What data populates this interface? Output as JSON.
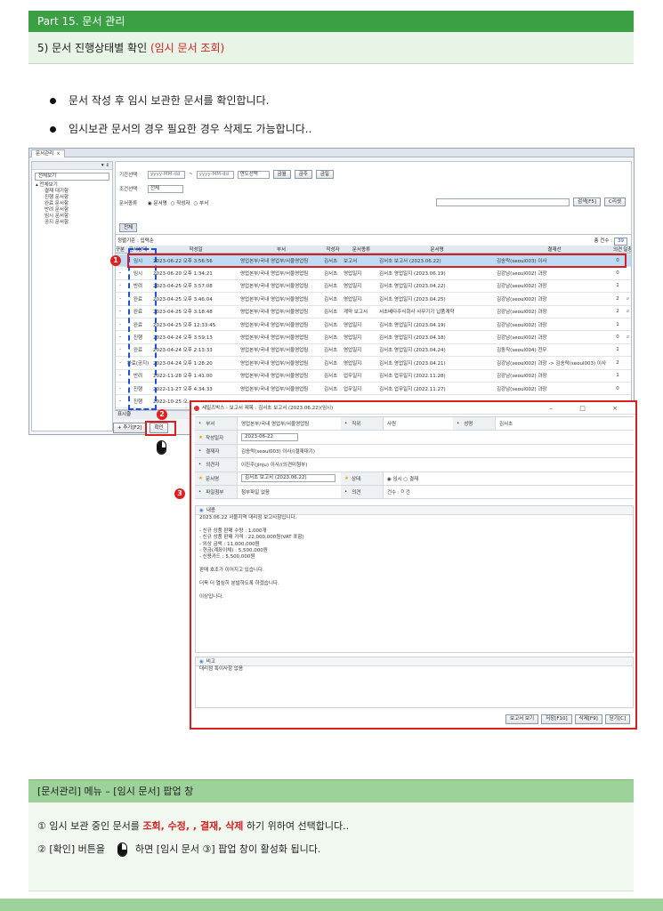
{
  "header": {
    "part": "Part 15. 문서 관리",
    "section_prefix": "5) 문서 진행상태별 확인",
    "section_highlight": "(임시 문서 조회)"
  },
  "bullets": [
    "문서 작성 후 임시 보관한 문서를 확인합니다.",
    "임시보관 문서의 경우 필요한 경우 삭제도 가능합니다.."
  ],
  "app": {
    "tab_label": "문서관리",
    "tab_close": "×",
    "tree_top": "▾ ⇓",
    "tree_search": "전체보기",
    "tree_root": "▴ 전체보기",
    "tree_items": [
      "결재 대기함",
      "진행 문서함",
      "완료 문서함",
      "반려 문서함",
      "임시 문서함",
      "공지 문서함"
    ],
    "filter": {
      "period_label": "기간선택",
      "date_from": "yyyy-MM-dd",
      "date_to": "yyyy-MM-dd",
      "year_select": "연도선택",
      "btn_week": "금월",
      "btn_month": "금주",
      "btn_today": "금일",
      "cond_label": "조건선택",
      "cond_value": "전체",
      "kind_label": "문서종류",
      "radio1": "◉ 문서명",
      "radio2": "○ 작성자",
      "radio3": "○ 부서",
      "search_btn": "검색[F5]",
      "reset_btn": "C리셋",
      "all_tab": "전체"
    },
    "grid": {
      "info_left": "정렬기준 : 입력순",
      "info_right": "총 건수 :",
      "total": "39",
      "headers": {
        "gubun": "구분",
        "status": "문서상태",
        "date": "작성일",
        "dept": "부서",
        "writer": "작성자",
        "kind": "문서종류",
        "name": "문서명",
        "approver": "결재선",
        "opinion": "의견",
        "file": "파일첨부"
      },
      "rows": [
        {
          "gubun": "-",
          "status": "임시",
          "date": "2023-06-22 오후 3:56:56",
          "dept": "영업본부/국내 영업부/서울영업팀",
          "writer": "김서초",
          "kind": "보고서",
          "name": "김서초 보고서 (2023.06.22)",
          "approver": "김송락(seoul003) 이사",
          "opinion": "0",
          "file": ""
        },
        {
          "gubun": "-",
          "status": "임시",
          "date": "2023-06-20 오후 1:34:21",
          "dept": "영업본부/국내 영업부/서울영업팀",
          "writer": "김서초",
          "kind": "영업일지",
          "name": "김서초 영업일지 (2023.06.19)",
          "approver": "김강남(seoul002) 과장",
          "opinion": "0",
          "file": ""
        },
        {
          "gubun": "-",
          "status": "반려",
          "date": "2023-04-25 오후 3:57:08",
          "dept": "영업본부/국내 영업부/서울영업팀",
          "writer": "김서초",
          "kind": "영업일지",
          "name": "김서초 영업일지 (2023.04.22)",
          "approver": "김강남(seoul002) 과장",
          "opinion": "1",
          "file": ""
        },
        {
          "gubun": "-",
          "status": "완료",
          "date": "2023-04-25 오후 3:46:04",
          "dept": "영업본부/국내 영업부/서울영업팀",
          "writer": "김서초",
          "kind": "영업일지",
          "name": "김서초 영업일지 (2023.04.25)",
          "approver": "김강남(seoul002) 과장",
          "opinion": "2",
          "file": "clip"
        },
        {
          "gubun": "-",
          "status": "완료",
          "date": "2023-04-25 오후 3:18:48",
          "dept": "영업본부/국내 영업부/서울영업팀",
          "writer": "김서초",
          "kind": "계약 보고서",
          "name": "서초베타주식회사 사무기기 납품계약",
          "approver": "김강남(seoul002) 과장",
          "opinion": "2",
          "file": "clip"
        },
        {
          "gubun": "-",
          "status": "완료",
          "date": "2023-04-25 오후 12:33:45",
          "dept": "영업본부/국내 영업부/서울영업팀",
          "writer": "김서초",
          "kind": "영업일지",
          "name": "김서초 영업일지 (2023.04.19)",
          "approver": "김강남(seoul002) 과장",
          "opinion": "1",
          "file": ""
        },
        {
          "gubun": "-",
          "status": "진행",
          "date": "2023-04-24 오후 3:59:13",
          "dept": "영업본부/국내 영업부/서울영업팀",
          "writer": "김서초",
          "kind": "영업일지",
          "name": "김서초 영업일지 (2023.04.18)",
          "approver": "김강남(seoul002) 과장",
          "opinion": "0",
          "file": "clip"
        },
        {
          "gubun": "-",
          "status": "완료",
          "date": "2023-04-24 오후 2:13:33",
          "dept": "영업본부/국내 영업부/서울영업팀",
          "writer": "김서초",
          "kind": "영업일지",
          "name": "김서초 영업일지 (2023.04.24)",
          "approver": "김동작(seoul004) 전무",
          "opinion": "1",
          "file": ""
        },
        {
          "gubun": "-",
          "status": "완료(공지)",
          "date": "2023-04-24 오후 1:28:20",
          "dept": "영업본부/국내 영업부/서울영업팀",
          "writer": "김서초",
          "kind": "영업일지",
          "name": "김서초 영업일지 (2023.04.21)",
          "approver": "김강남(seoul002) 과장 -> 김송락(seoul003) 이사",
          "opinion": "2",
          "file": ""
        },
        {
          "gubun": "-",
          "status": "반려",
          "date": "2022-11-28 오후 1:41:00",
          "dept": "영업본부/국내 영업부/서울영업팀",
          "writer": "김서초",
          "kind": "업무일지",
          "name": "김서초 업무일지 (2022.11.28)",
          "approver": "김강남(seoul002) 과장",
          "opinion": "1",
          "file": ""
        },
        {
          "gubun": "-",
          "status": "진행",
          "date": "2022-11-27 오후 4:34:33",
          "dept": "영업본부/국내 영업부/서울영업팀",
          "writer": "김서초",
          "kind": "업무일지",
          "name": "김서초 업무일지 (2022.11.27)",
          "approver": "김강남(seoul002) 과장",
          "opinion": "0",
          "file": ""
        },
        {
          "gubun": "-",
          "status": "진행",
          "date": "2022-10-25 오...",
          "dept": "",
          "writer": "",
          "kind": "",
          "name": "",
          "approver": "",
          "opinion": "",
          "file": ""
        }
      ]
    },
    "bottom_label": "표시줄",
    "add_btn": "+ 추가[F2]",
    "confirm_btn": "확인"
  },
  "badges": {
    "b1": "1",
    "b2": "2",
    "b3": "3"
  },
  "popup": {
    "title": "세일즈박스 - 보고서 제목 : 김서초 보고서 (2023.06.22)(임시)",
    "controls": "– □ ×",
    "fields": {
      "dept_label": "부서",
      "dept_value": "영업본부/국내 영업부/서울영업팀",
      "rank_label": "직위",
      "rank_value": "사원",
      "name_label": "성명",
      "name_value": "김서초",
      "date_label": "작성일자",
      "date_value": "2023-06-22",
      "approver_label": "결재자",
      "approver_value": "김송락(seoul003) 이사/(결재대기)",
      "opinion_label": "의견자",
      "opinion_value": "이진주(jinju) 이사/(의견미첨부)",
      "docname_label": "문서명",
      "docname_value": "김서초 보고서 (2023.06.22)",
      "state_label": "상태",
      "state_value": "◉ 임시  ○ 결재",
      "file_label": "파일첨부",
      "file_value": "첨부파일 없음",
      "op_label": "의견",
      "op_value_prefix": "건수 :",
      "op_count": "0",
      "op_suffix": "건"
    },
    "content_label": "내용",
    "content_lines": [
      "2023.06.22 서울지역 대리점 보고사항입니다.",
      "",
      "- 신규 상품 판매 수량 : 1,000개",
      "- 신규 상품 판매 가격 : 22,000,000원(VAT 포함)",
      "- 외상 금액 : 11,000,000원",
      "- 현금(계좌이체) : 5,500,000원",
      "- 신용카드 : 5,500,000원",
      "",
      "판매 호조가 이어지고 있습니다.",
      "",
      "더욱 더 열심히 분발하도록 하겠습니다.",
      "",
      "이상입니다."
    ],
    "remark_label": "비고",
    "remark_value": "대리점 특이사항 없음",
    "btn_view": "보고서 보기",
    "btn_save": "저장[F10]",
    "btn_delete": "삭제[F9]",
    "btn_close": "닫기[C]"
  },
  "explain": {
    "bar": "[문서관리] 메뉴 – [임시 문서] 팝업 창",
    "line1_a": "①  임시 보관 중인 문서를 ",
    "line1_r": "조회, 수정, , 결재, 삭제",
    "line1_b": " 하기 위하여    선택합니다..",
    "line2_a": "②  [확인] 버튼을",
    "line2_b": "하면  [임시 문서 ③]  팝업 창이 활성화 됩니다."
  }
}
